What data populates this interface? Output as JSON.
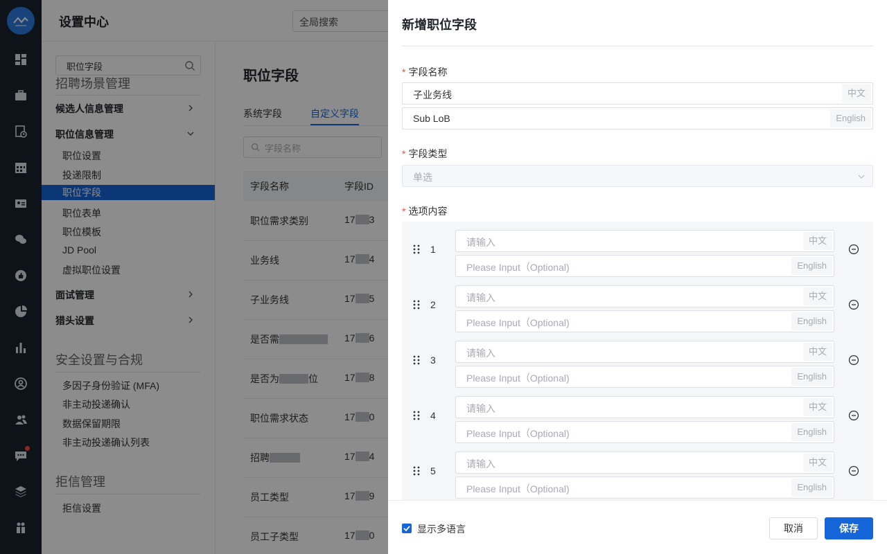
{
  "header": {
    "title": "设置中心",
    "global_search": "全局搜索"
  },
  "sidebar": {
    "search_value": "职位字段",
    "section_recruit": "招聘场景管理",
    "groups": [
      {
        "label": "候选人信息管理",
        "expanded": false
      },
      {
        "label": "职位信息管理",
        "expanded": true
      },
      {
        "label": "面试管理",
        "expanded": false
      },
      {
        "label": "猎头设置",
        "expanded": false
      }
    ],
    "job_items": [
      "职位设置",
      "投递限制",
      "职位字段",
      "职位表单",
      "职位模板",
      "JD Pool",
      "虚拟职位设置"
    ],
    "active_item": "职位字段",
    "section_security": "安全设置与合规",
    "security_items": [
      "多因子身份验证 (MFA)",
      "非主动投递确认",
      "数据保留期限",
      "非主动投递确认列表"
    ],
    "section_reject": "拒信管理",
    "reject_items": [
      "拒信设置"
    ]
  },
  "main": {
    "title": "职位字段",
    "tabs": [
      "系统字段",
      "自定义字段"
    ],
    "active_tab": "自定义字段",
    "filter_placeholder": "字段名称",
    "columns": [
      "字段名称",
      "字段ID"
    ],
    "rows": [
      {
        "name": "职位需求类别",
        "id_prefix": "17",
        "id_suffix": "3"
      },
      {
        "name": "业务线",
        "id_prefix": "17",
        "id_suffix": "4"
      },
      {
        "name": "子业务线",
        "id_prefix": "17",
        "id_suffix": "5"
      },
      {
        "name": "是否需",
        "id_prefix": "17",
        "id_suffix": "6"
      },
      {
        "name": "是否为",
        "name_tail": "位",
        "id_prefix": "17",
        "id_suffix": "8"
      },
      {
        "name": "职位需求状态",
        "id_prefix": "17",
        "id_suffix": "0"
      },
      {
        "name": "招聘",
        "id_prefix": "17",
        "id_suffix": "4"
      },
      {
        "name": "员工类型",
        "id_prefix": "17",
        "id_suffix": "9"
      },
      {
        "name": "员工子类型",
        "id_prefix": "17",
        "id_suffix": "0"
      }
    ]
  },
  "drawer": {
    "title": "新增职位字段",
    "field_name_label": "字段名称",
    "field_name_zh": "子业务线",
    "field_name_en": "Sub LoB",
    "lang_zh": "中文",
    "lang_en": "English",
    "field_type_label": "字段类型",
    "field_type_value": "单选",
    "options_label": "选项内容",
    "option_zh_placeholder": "请输入",
    "option_en_placeholder": "Please Input（Optional)",
    "options": [
      "1",
      "2",
      "3",
      "4",
      "5"
    ],
    "show_multilang_label": "显示多语言",
    "show_multilang_checked": true,
    "cancel_label": "取消",
    "save_label": "保存"
  },
  "colors": {
    "primary": "#1565d8",
    "rail_bg": "#1b2430",
    "required": "#f54a45"
  }
}
